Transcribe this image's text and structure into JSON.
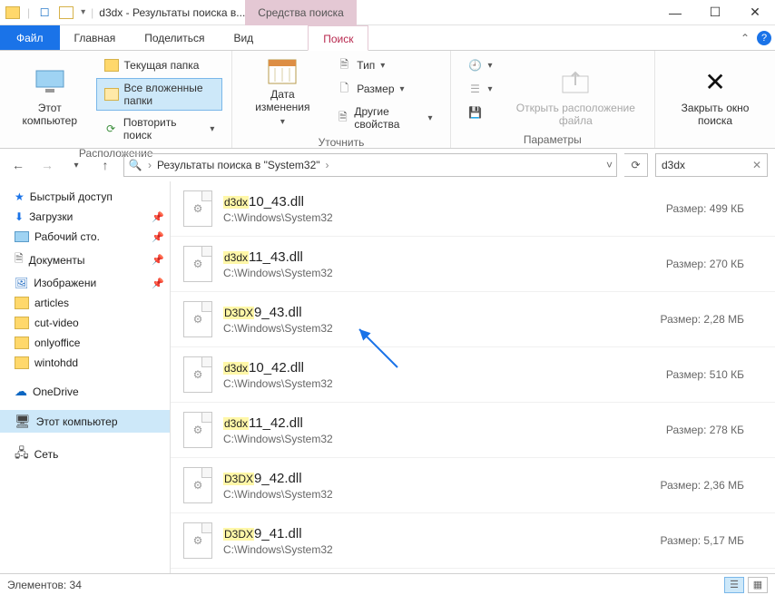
{
  "window": {
    "title": "d3dx - Результаты поиска в...",
    "contextual_tab": "Средства поиска"
  },
  "tabs": {
    "file": "Файл",
    "home": "Главная",
    "share": "Поделиться",
    "view": "Вид",
    "search": "Поиск"
  },
  "ribbon": {
    "group_location": "Расположение",
    "this_pc": "Этот компьютер",
    "current_folder": "Текущая папка",
    "all_subfolders": "Все вложенные папки",
    "search_again": "Повторить поиск",
    "group_refine": "Уточнить",
    "date_modified": "Дата изменения",
    "type": "Тип",
    "size": "Размер",
    "other_props": "Другие свойства",
    "group_options": "Параметры",
    "open_location": "Открыть расположение файла",
    "close_search": "Закрыть окно поиска"
  },
  "addr": {
    "breadcrumb_prefix": "Результаты поиска в \"System32\""
  },
  "search_box": {
    "query": "d3dx"
  },
  "sidebar": {
    "quick": "Быстрый доступ",
    "downloads": "Загрузки",
    "desktop": "Рабочий сто.",
    "documents": "Документы",
    "pictures": "Изображени",
    "articles": "articles",
    "cutvideo": "cut-video",
    "onlyoffice": "onlyoffice",
    "wintohdd": "wintohdd",
    "onedrive": "OneDrive",
    "thispc": "Этот компьютер",
    "network": "Сеть"
  },
  "results": [
    {
      "name_hl": "d3dx",
      "name_rest": "10_43.dll",
      "path": "C:\\Windows\\System32",
      "size": "Размер: 499 КБ"
    },
    {
      "name_hl": "d3dx",
      "name_rest": "11_43.dll",
      "path": "C:\\Windows\\System32",
      "size": "Размер: 270 КБ"
    },
    {
      "name_hl": "D3DX",
      "name_rest": "9_43.dll",
      "path": "C:\\Windows\\System32",
      "size": "Размер: 2,28 МБ"
    },
    {
      "name_hl": "d3dx",
      "name_rest": "10_42.dll",
      "path": "C:\\Windows\\System32",
      "size": "Размер: 510 КБ"
    },
    {
      "name_hl": "d3dx",
      "name_rest": "11_42.dll",
      "path": "C:\\Windows\\System32",
      "size": "Размер: 278 КБ"
    },
    {
      "name_hl": "D3DX",
      "name_rest": "9_42.dll",
      "path": "C:\\Windows\\System32",
      "size": "Размер: 2,36 МБ"
    },
    {
      "name_hl": "D3DX",
      "name_rest": "9_41.dll",
      "path": "C:\\Windows\\System32",
      "size": "Размер: 5,17 МБ"
    }
  ],
  "status": {
    "elements": "Элементов: 34"
  }
}
